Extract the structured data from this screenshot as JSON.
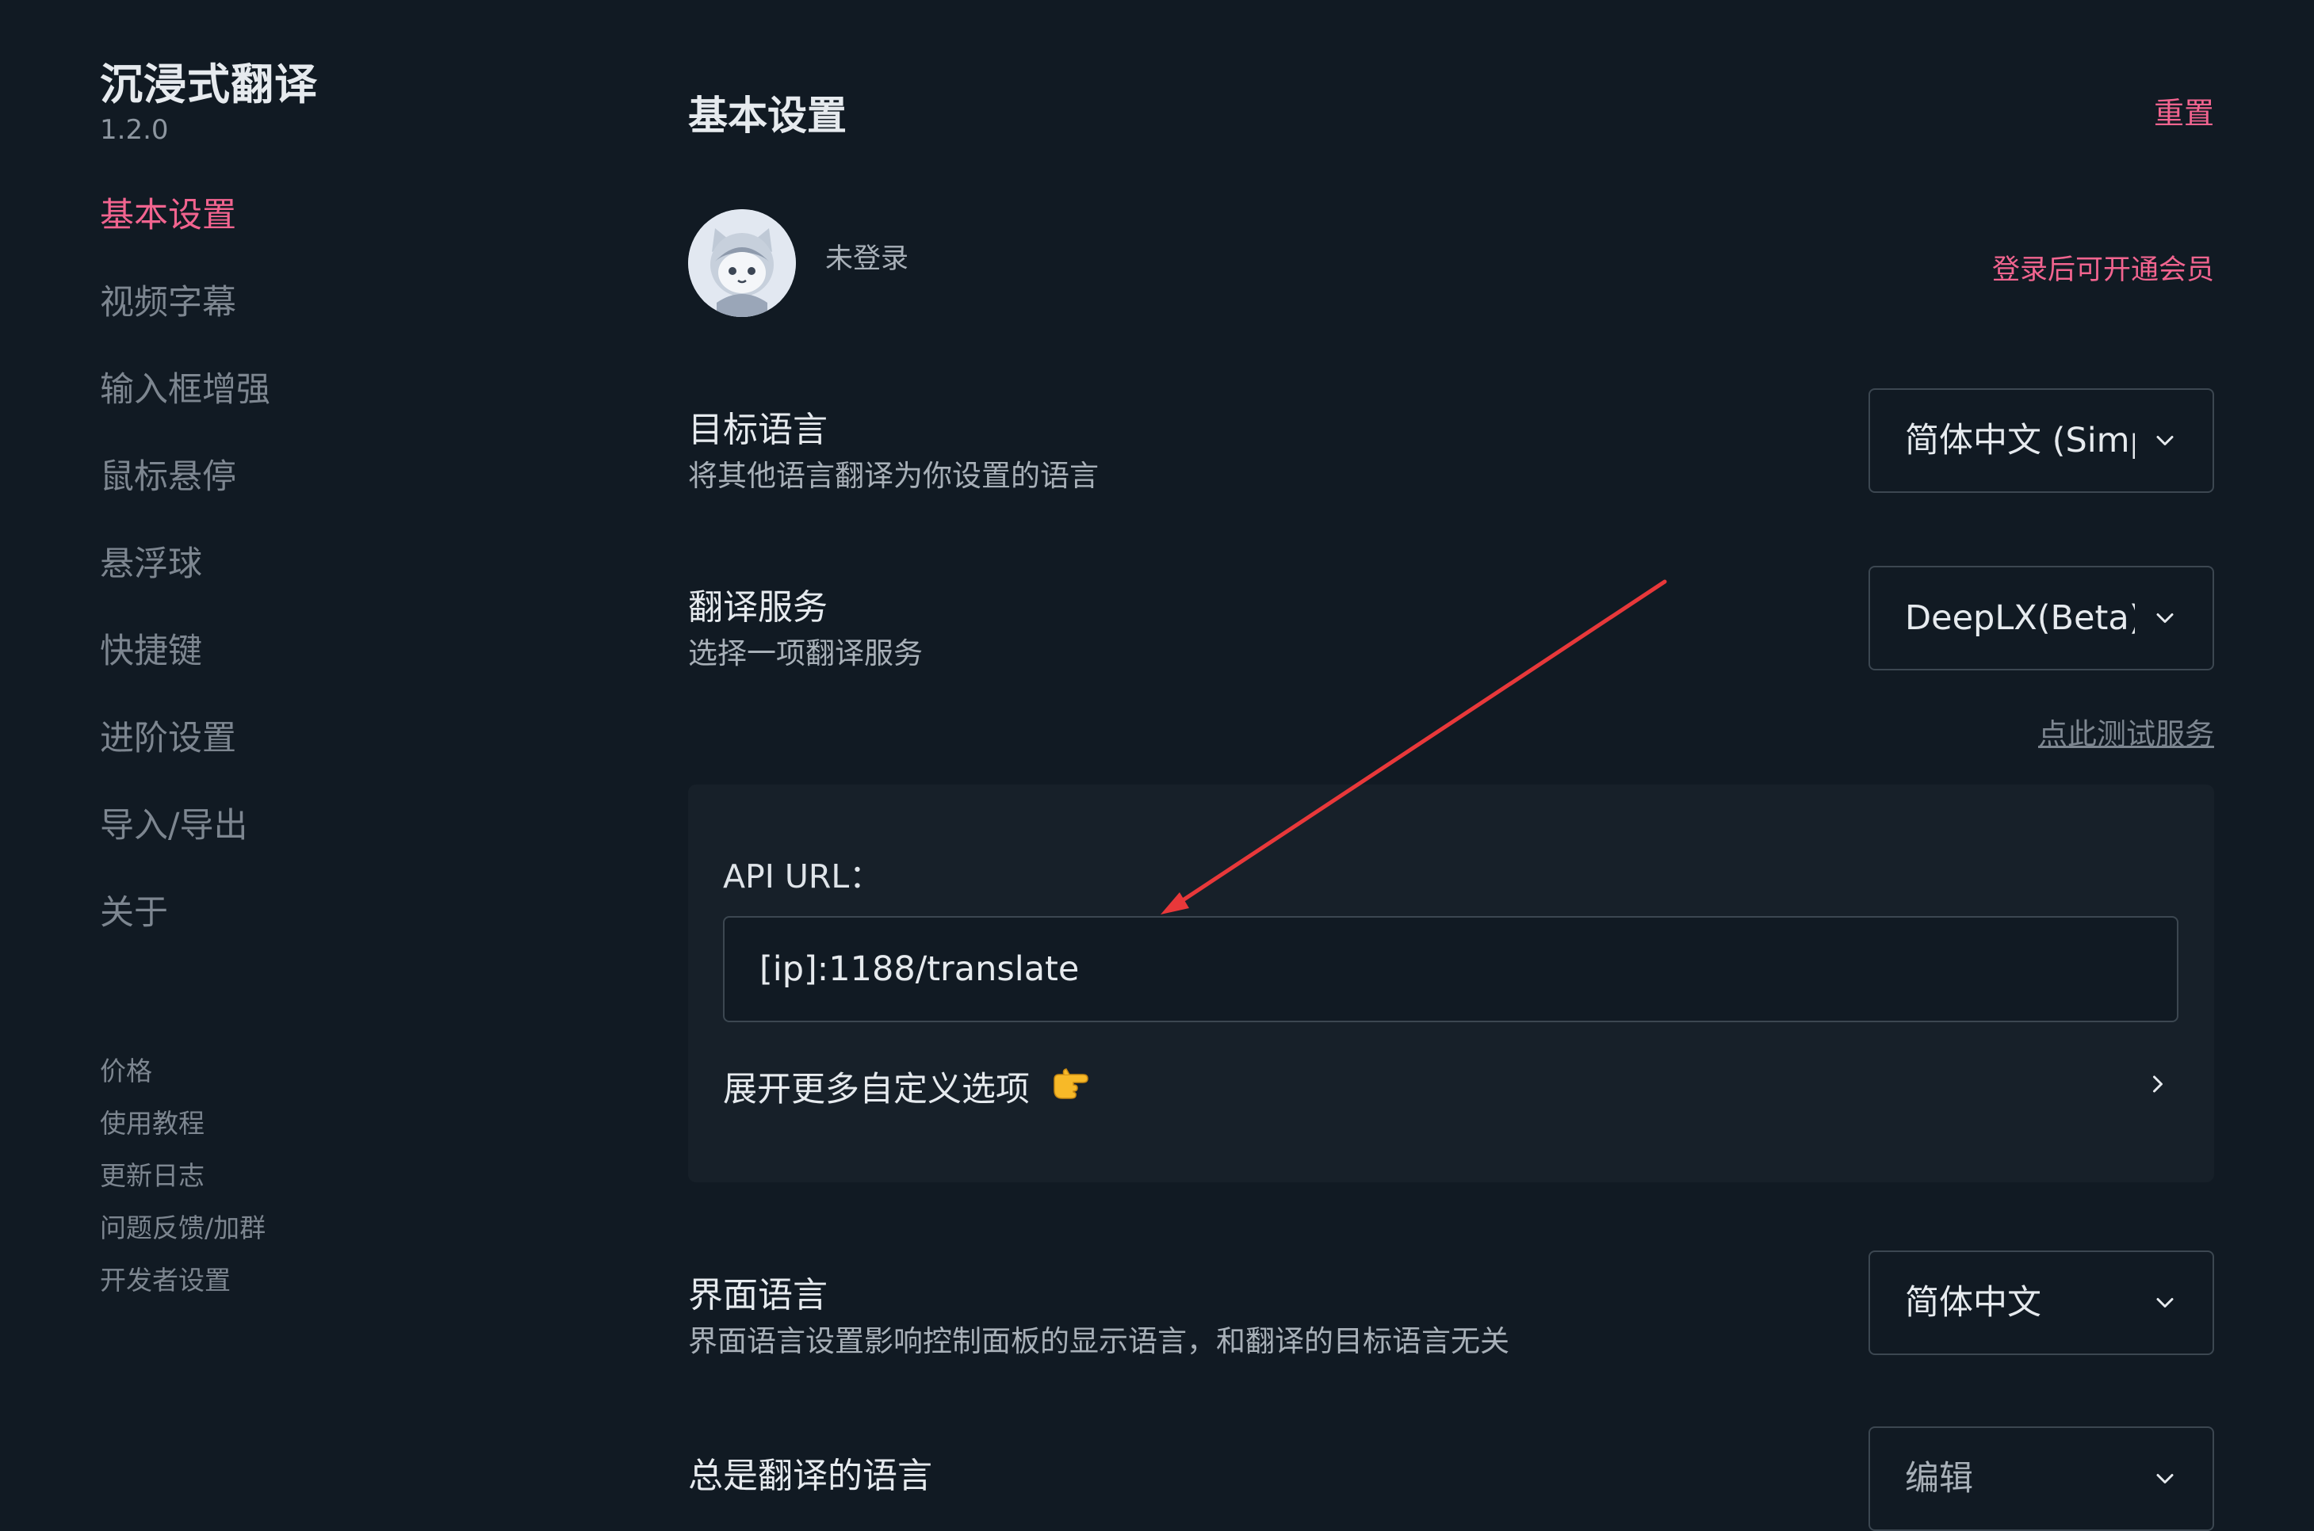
{
  "app": {
    "title": "沉浸式翻译",
    "version": "1.2.0"
  },
  "sidebar": {
    "items": [
      {
        "label": "基本设置",
        "active": true
      },
      {
        "label": "视频字幕"
      },
      {
        "label": "输入框增强"
      },
      {
        "label": "鼠标悬停"
      },
      {
        "label": "悬浮球"
      },
      {
        "label": "快捷键"
      },
      {
        "label": "进阶设置"
      },
      {
        "label": "导入/导出"
      },
      {
        "label": "关于"
      }
    ],
    "footer_links": [
      {
        "label": "价格"
      },
      {
        "label": "使用教程"
      },
      {
        "label": "更新日志"
      },
      {
        "label": "问题反馈/加群"
      },
      {
        "label": "开发者设置"
      }
    ]
  },
  "main": {
    "title": "基本设置",
    "reset_label": "重置",
    "account": {
      "status": "未登录",
      "vip_link": "登录后可开通会员"
    },
    "target_language": {
      "title": "目标语言",
      "desc": "将其他语言翻译为你设置的语言",
      "value": "简体中文 (Simp"
    },
    "translation_service": {
      "title": "翻译服务",
      "desc": "选择一项翻译服务",
      "value": "DeepLX(Beta)"
    },
    "test_service_link": "点此测试服务",
    "api": {
      "label": "API URL：",
      "value": "[ip]:1188/translate",
      "expand_label": "展开更多自定义选项"
    },
    "ui_language": {
      "title": "界面语言",
      "desc": "界面语言设置影响控制面板的显示语言，和翻译的目标语言无关",
      "value": "简体中文"
    },
    "always_translate": {
      "title": "总是翻译的语言",
      "value": "编辑"
    }
  },
  "colors": {
    "background": "#111a23",
    "panel": "#172029",
    "accent": "#f1648f",
    "muted": "#7d8690",
    "annotation_arrow": "#e8383a"
  },
  "icons": {
    "select_chevron": "chevron-down-icon",
    "expand_chevron": "chevron-right-icon",
    "pointing": "backhand-index-pointing-right-icon",
    "avatar": "cat-avatar-icon"
  }
}
